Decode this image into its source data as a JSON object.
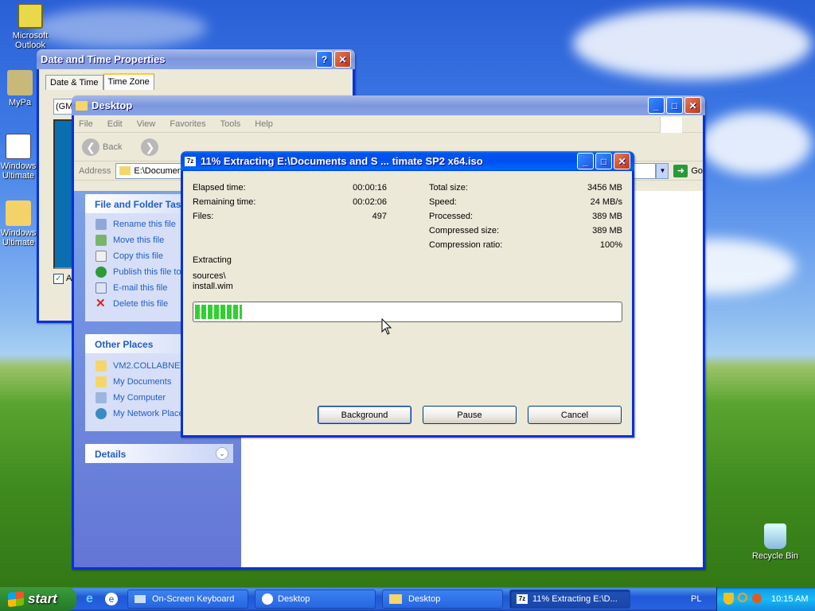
{
  "desktop": {
    "icons": [
      {
        "label": "Microsoft Outlook",
        "short": "Microsoft\nOutlook",
        "icon": "outlook-icon"
      },
      {
        "label": "MyPa",
        "icon": "mypc-icon"
      },
      {
        "label": "Windows Ultimate",
        "icon": "windows-ultimate-icon"
      },
      {
        "label": "Windows Ultimate",
        "icon": "folder-icon"
      },
      {
        "label": "Recycle Bin",
        "icon": "recycle-bin-icon"
      }
    ]
  },
  "datetime": {
    "title": "Date and Time Properties",
    "tabs": [
      "Date & Time",
      "Time Zone"
    ],
    "timezone_value": "(GM",
    "checkbox_label": "A"
  },
  "explorer": {
    "title": "Desktop",
    "menu": [
      "File",
      "Edit",
      "View",
      "Favorites",
      "Tools",
      "Help"
    ],
    "back_label": "Back",
    "address_label": "Address",
    "address_value": "E:\\Documents and Settings",
    "go_label": "Go",
    "file_tasks": {
      "title": "File and Folder Tasks",
      "items": [
        "Rename this file",
        "Move this file",
        "Copy this file",
        "Publish this file to the Web",
        "E-mail this file",
        "Delete this file"
      ]
    },
    "other_places": {
      "title": "Other Places",
      "items": [
        "VM2.COLLABNET",
        "My Documents",
        "My Computer",
        "My Network Places"
      ]
    },
    "details": {
      "title": "Details"
    }
  },
  "extract": {
    "title": "11% Extracting E:\\Documents and S ... timate SP2 x64.iso",
    "progress_percent": 11,
    "left": [
      {
        "label": "Elapsed time:",
        "value": "00:00:16"
      },
      {
        "label": "Remaining time:",
        "value": "00:02:06"
      },
      {
        "label": "Files:",
        "value": "497"
      }
    ],
    "right": [
      {
        "label": "Total size:",
        "value": "3456 MB"
      },
      {
        "label": "Speed:",
        "value": "24 MB/s"
      },
      {
        "label": "Processed:",
        "value": "389 MB"
      },
      {
        "label": "Compressed size:",
        "value": "389 MB"
      },
      {
        "label": "Compression ratio:",
        "value": "100%"
      }
    ],
    "status": "Extracting",
    "path_line1": "sources\\",
    "path_line2": "install.wim",
    "buttons": {
      "background": "Background",
      "pause": "Pause",
      "cancel": "Cancel"
    }
  },
  "taskbar": {
    "start": "start",
    "tasks": [
      {
        "label": "On-Screen Keyboard"
      },
      {
        "label": "Desktop"
      },
      {
        "label": "Desktop"
      },
      {
        "label": "11% Extracting E:\\D..."
      }
    ],
    "language": "PL",
    "clock": "10:15 AM"
  }
}
